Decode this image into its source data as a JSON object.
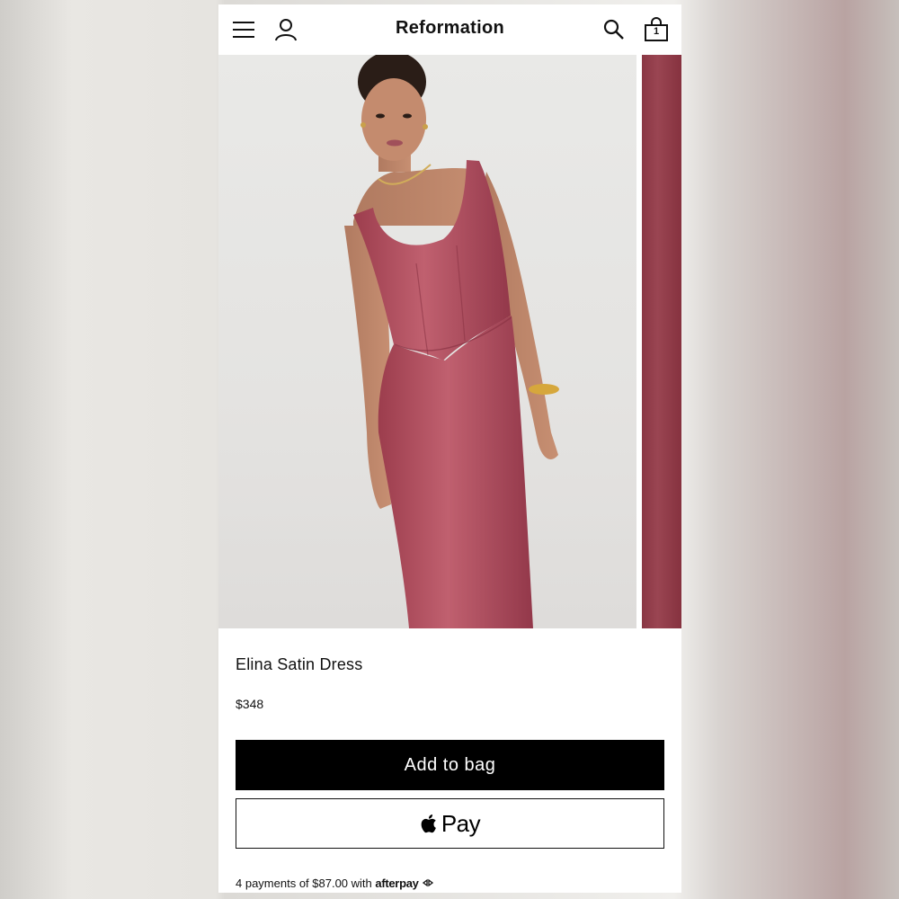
{
  "header": {
    "brand": "Reformation",
    "bag_count": "1",
    "icons": [
      "menu-icon",
      "account-icon",
      "search-icon",
      "shopping-bag-icon"
    ]
  },
  "gallery": {
    "main_image": "model-wearing-rose-satin-corset-midi-dress",
    "next_image": "dress-fabric-closeup"
  },
  "product": {
    "name": "Elina Satin Dress",
    "price": "$348",
    "add_to_bag_label": "Add to bag",
    "apple_pay_label": "Pay",
    "afterpay_text": "4 payments of $87.00 with",
    "afterpay_brand": "afterpay"
  },
  "colors": {
    "dress": "#b0505f",
    "button_primary": "#000000",
    "background": "#ffffff"
  }
}
